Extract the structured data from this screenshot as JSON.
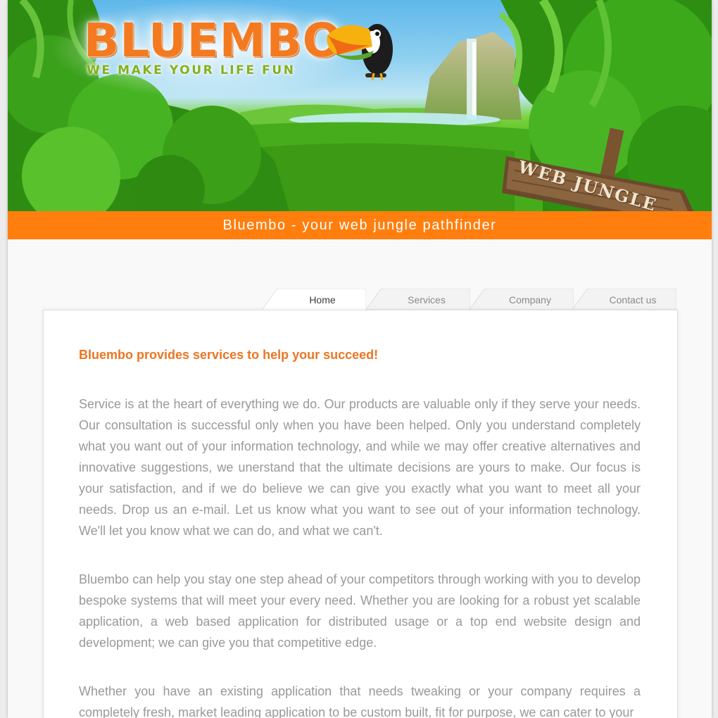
{
  "brand": {
    "logo_text": "BLUEMBO",
    "tagline": "WE MAKE YOUR LIFE FUN",
    "sign_text": "WEB JUNGLE"
  },
  "banner": {
    "slogan": "Bluembo - your web jungle pathfinder"
  },
  "nav": {
    "tabs": [
      {
        "label": "Home",
        "active": true
      },
      {
        "label": "Services",
        "active": false
      },
      {
        "label": "Company",
        "active": false
      },
      {
        "label": "Contact us",
        "active": false
      }
    ]
  },
  "content": {
    "heading": "Bluembo provides services to help your succeed!",
    "paragraphs": [
      "Service is at the heart of everything we do. Our products are valuable only if they serve your needs. Our consultation is successful only when you have been helped. Only you understand completely what you want out of your information technology, and while we may offer creative alternatives and innovative suggestions, we unerstand that the ultimate decisions are yours to make. Our focus is your satisfaction, and if we do believe we can give you exactly what you want to meet all your needs. Drop us an e-mail. Let us know what you want to see out of your information technology. We'll let you know what we can do, and what we can't.",
      "Bluembo can help you stay one step ahead of your competitors through working with you to develop bespoke systems that will meet your every need. Whether you are looking for a robust yet scalable application, a web based application for distributed usage or a top end website design and development; we can give you that competitive edge.",
      "Whether you have an existing application that needs tweaking or your company requires a completely fresh, market leading application to be custom built, fit for purpose, we can cater to your"
    ]
  },
  "colors": {
    "accent_orange": "#ff7e0e",
    "heading_orange": "#ec7521",
    "body_text": "#999999",
    "logo_orange": "#f37a20",
    "tagline_green": "#84b01d"
  },
  "icons": {
    "mascot": "toucan-icon",
    "sign": "wooden-sign-icon"
  }
}
